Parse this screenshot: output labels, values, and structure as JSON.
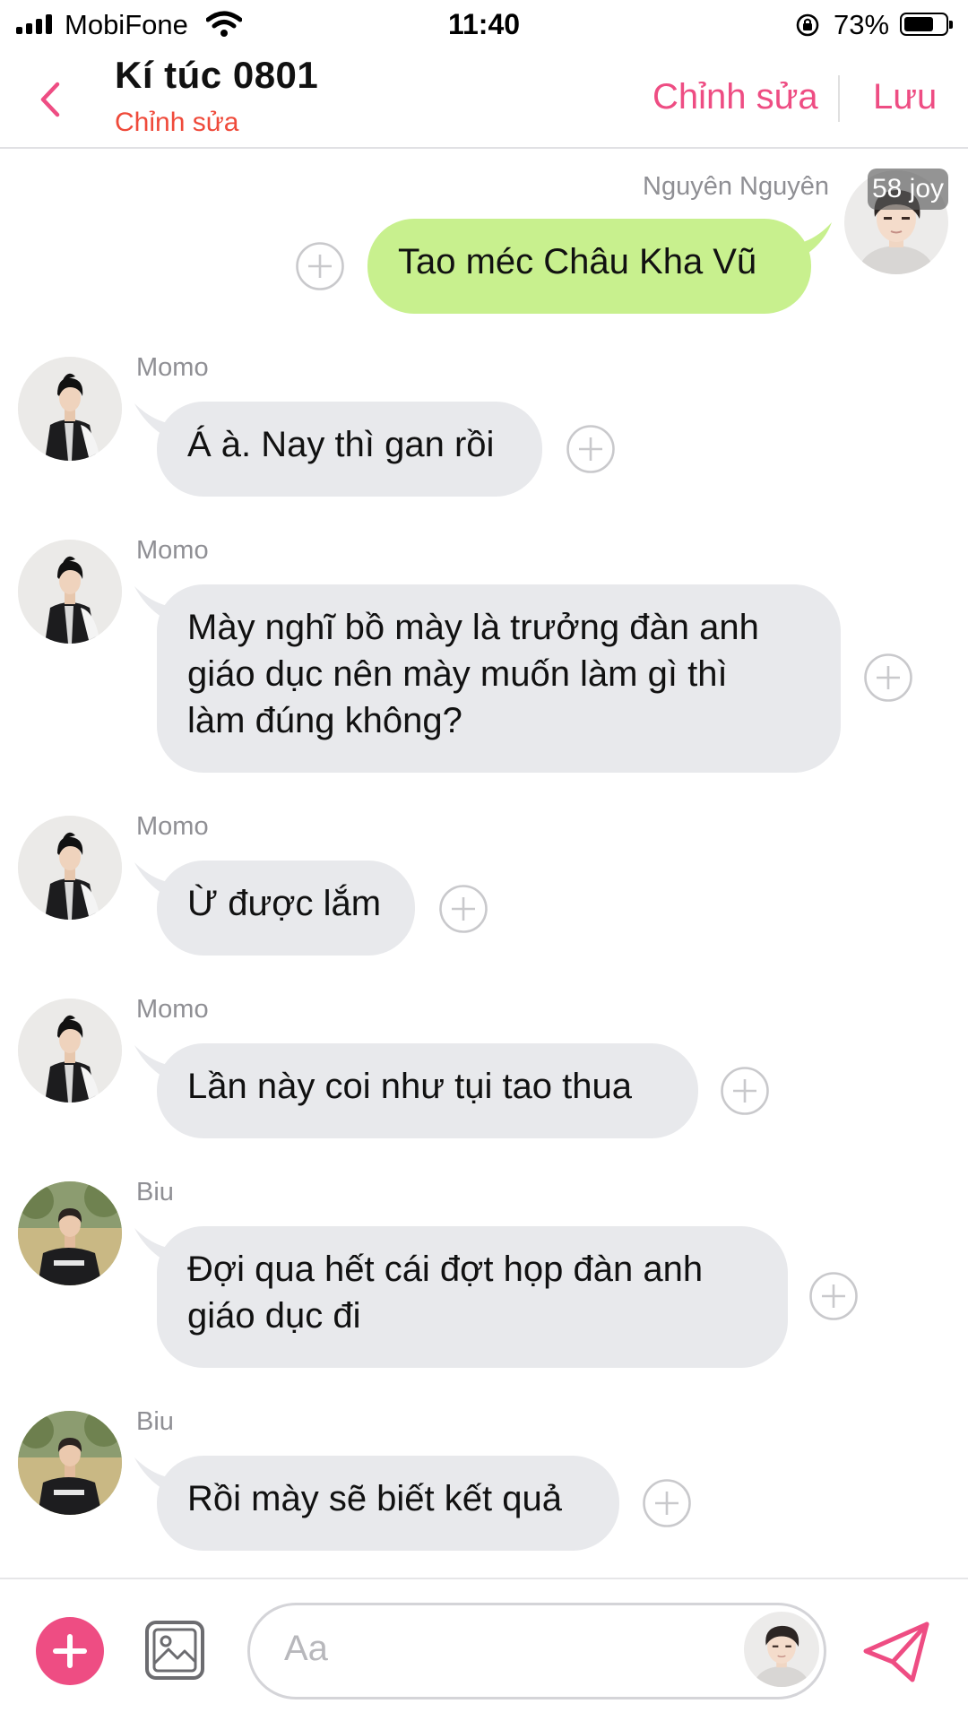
{
  "status": {
    "carrier": "MobiFone",
    "time": "11:40",
    "battery": "73%",
    "battery_level": 0.73
  },
  "header": {
    "title": "Kí túc 0801",
    "subtitle": "Chỉnh sửa",
    "edit_label": "Chỉnh sửa",
    "save_label": "Lưu"
  },
  "messages": [
    {
      "sender": "Nguyên Nguyên",
      "text": "Tao méc Châu Kha Vũ",
      "direction": "outgoing",
      "avatar_badge": "58 joy"
    },
    {
      "sender": "Momo",
      "text": "Á à. Nay thì gan rồi",
      "direction": "incoming"
    },
    {
      "sender": "Momo",
      "text": "Mày nghĩ bồ mày là trưởng đàn anh giáo dục nên mày muốn làm gì thì làm đúng không?",
      "lines": [
        "Mày nghĩ bồ mày là trưởng đàn anh",
        "giáo dục nên mày muốn làm gì thì",
        "làm đúng không?"
      ],
      "direction": "incoming"
    },
    {
      "sender": "Momo",
      "text": "Ừ được lắm",
      "direction": "incoming"
    },
    {
      "sender": "Momo",
      "text": "Lần này coi như tụi tao thua",
      "direction": "incoming"
    },
    {
      "sender": "Biu",
      "text": "Đợi qua hết cái đợt họp đàn anh giáo dục đi",
      "lines": [
        "Đợi qua hết cái đợt họp đàn anh",
        "giáo dục đi"
      ],
      "direction": "incoming"
    },
    {
      "sender": "Biu",
      "text": "Rồi mày sẽ biết kết quả",
      "direction": "incoming"
    }
  ],
  "input": {
    "placeholder": "Aa"
  },
  "icons": {
    "back": "chevron-left-icon",
    "add_reaction": "plus-circle-icon",
    "attach": "plus-icon",
    "image": "image-icon",
    "send": "send-icon"
  },
  "colors": {
    "accent": "#ee4d83",
    "subtitle": "#ef4a3a",
    "outgoing_bubble": "#c8f08e",
    "incoming_bubble": "#e8e9ec"
  }
}
